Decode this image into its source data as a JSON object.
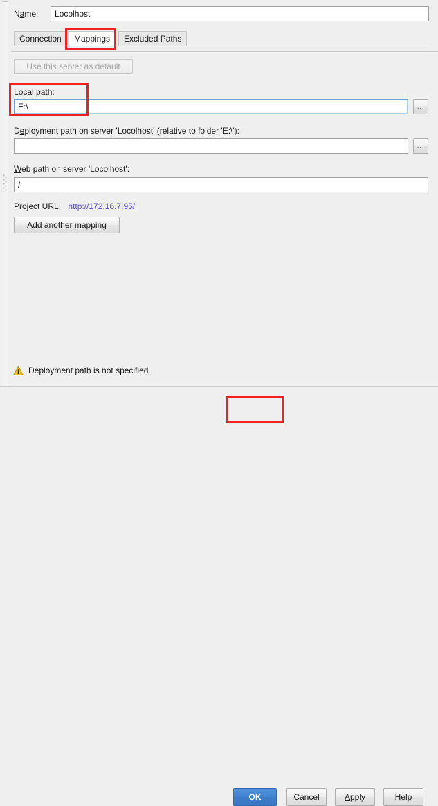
{
  "window": {
    "name_label": "Name:",
    "name_value": "Locolhost"
  },
  "tabs": [
    {
      "label": "Connection",
      "selected": false
    },
    {
      "label": "Mappings",
      "selected": true
    },
    {
      "label": "Excluded Paths",
      "selected": false
    }
  ],
  "mappings": {
    "use_default_button": "Use this server as default",
    "use_default_disabled": true,
    "local_path": {
      "label": "Local path:",
      "value": "E:\\",
      "browse_label": "...",
      "focused": true
    },
    "deployment_path": {
      "label": "Deployment path on server 'Locolhost' (relative to folder 'E:\\'):",
      "value": "",
      "browse_label": "..."
    },
    "web_path": {
      "label": "Web path on server 'Locolhost':",
      "value": "/"
    },
    "project_url": {
      "label": "Project URL:",
      "url": "http://172.16.7.95/"
    },
    "add_mapping_button": "Add another mapping"
  },
  "status": {
    "warning_icon": "warning-triangle-icon",
    "warning_text": "Deployment path is not specified."
  },
  "footer": {
    "ok": "OK",
    "cancel": "Cancel",
    "apply": "Apply",
    "help": "Help"
  },
  "colors": {
    "ok_accent": "#4283cf",
    "link": "#5b4fc9",
    "annotation": "#f02020",
    "warning": "#e8b11c",
    "background": "#efefef"
  }
}
